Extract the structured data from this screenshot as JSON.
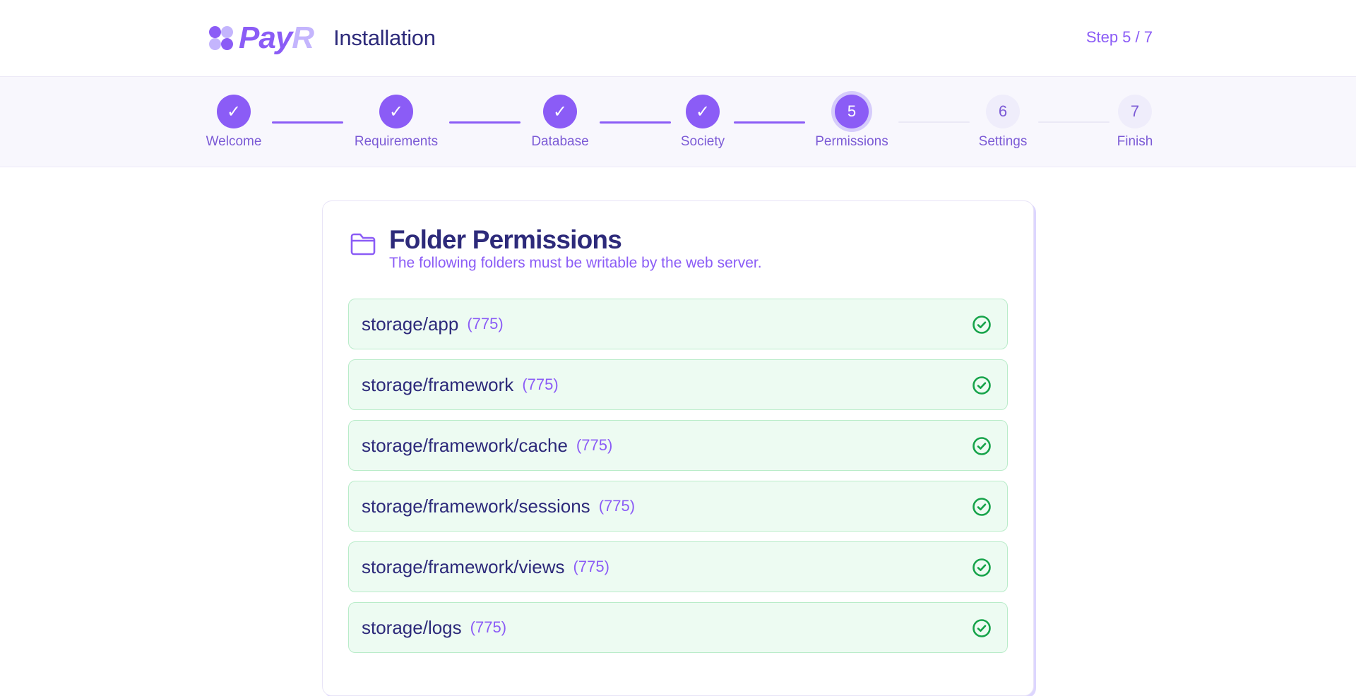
{
  "header": {
    "logo_part1": "Pay",
    "logo_part2": "R",
    "title": "Installation",
    "step_indicator": "Step 5 / 7"
  },
  "stepper": {
    "steps": [
      {
        "label": "Welcome",
        "marker": "✓",
        "state": "done"
      },
      {
        "label": "Requirements",
        "marker": "✓",
        "state": "done"
      },
      {
        "label": "Database",
        "marker": "✓",
        "state": "done"
      },
      {
        "label": "Society",
        "marker": "✓",
        "state": "done"
      },
      {
        "label": "Permissions",
        "marker": "5",
        "state": "active"
      },
      {
        "label": "Settings",
        "marker": "6",
        "state": "todo"
      },
      {
        "label": "Finish",
        "marker": "7",
        "state": "todo"
      }
    ]
  },
  "card": {
    "title": "Folder Permissions",
    "subtitle": "The following folders must be writable by the web server.",
    "icon": "folder-icon",
    "folders": [
      {
        "path": "storage/app",
        "perm": "(775)",
        "status": "check-circle-icon"
      },
      {
        "path": "storage/framework",
        "perm": "(775)",
        "status": "check-circle-icon"
      },
      {
        "path": "storage/framework/cache",
        "perm": "(775)",
        "status": "check-circle-icon"
      },
      {
        "path": "storage/framework/sessions",
        "perm": "(775)",
        "status": "check-circle-icon"
      },
      {
        "path": "storage/framework/views",
        "perm": "(775)",
        "status": "check-circle-icon"
      },
      {
        "path": "storage/logs",
        "perm": "(775)",
        "status": "check-circle-icon"
      }
    ]
  },
  "colors": {
    "accent": "#8b5cf6",
    "accent_light": "#c4b5fd",
    "heading": "#2d2a7a",
    "success": "#16a34a",
    "success_bg": "#edfbf2"
  }
}
